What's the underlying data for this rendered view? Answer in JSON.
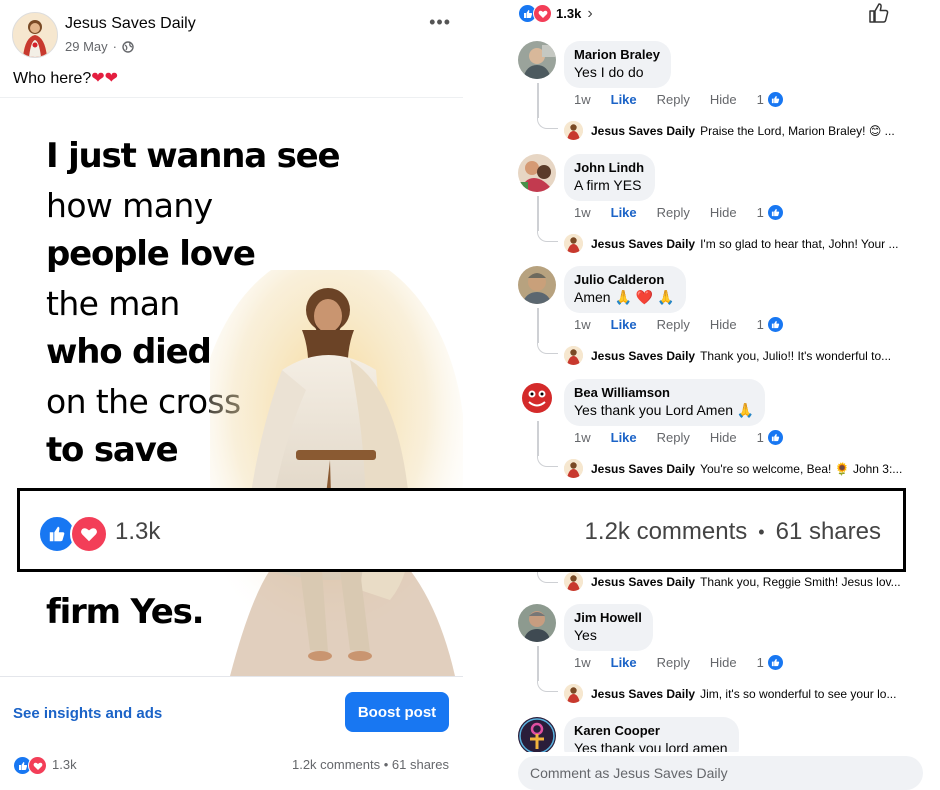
{
  "post": {
    "page_name": "Jesus Saves Daily",
    "date": "29 May",
    "separator": "·",
    "caption": "Who here?",
    "caption_emoji": "❤❤",
    "more_icon": "more-horizontal-icon",
    "image_text": {
      "line1": "I just wanna see",
      "line2": "how many",
      "line3": "people love",
      "line4": "the man",
      "line5": "who died",
      "line6": "on the cross",
      "line7": "to save",
      "final": "firm Yes."
    },
    "insights_link": "See insights and ads",
    "boost_button": "Boost post",
    "reaction_count": "1.3k",
    "comments_shares": "1.2k comments • 61 shares"
  },
  "overlay": {
    "reaction_count": "1.3k",
    "comments": "1.2k comments",
    "dot": "•",
    "shares": "61 shares"
  },
  "comments_panel": {
    "reaction_count": "1.3k",
    "chevron": "›",
    "comments": [
      {
        "name": "Marion Braley",
        "text": "Yes I do do",
        "time": "1w",
        "like": "Like",
        "reply": "Reply",
        "hide": "Hide",
        "reactions": "1",
        "reply_author": "Jesus Saves Daily",
        "reply_text": "Praise the Lord, Marion Braley! 😊 ..."
      },
      {
        "name": "John Lindh",
        "text": "A firm YES",
        "time": "1w",
        "like": "Like",
        "reply": "Reply",
        "hide": "Hide",
        "reactions": "1",
        "reply_author": "Jesus Saves Daily",
        "reply_text": "I'm so glad to hear that, John! Your ..."
      },
      {
        "name": "Julio Calderon",
        "text": "Amen 🙏 ❤️ 🙏",
        "time": "1w",
        "like": "Like",
        "reply": "Reply",
        "hide": "Hide",
        "reactions": "1",
        "reply_author": "Jesus Saves Daily",
        "reply_text": "Thank you, Julio!! It's wonderful to..."
      },
      {
        "name": "Bea Williamson",
        "text": "Yes thank you Lord Amen 🙏",
        "time": "1w",
        "like": "Like",
        "reply": "Reply",
        "hide": "Hide",
        "reactions": "1",
        "reply_author": "Jesus Saves Daily",
        "reply_text": "You're so welcome, Bea! 🌻 John 3:..."
      },
      {
        "reply_author": "Jesus Saves Daily",
        "reply_text": "Thank you, Reggie Smith! Jesus lov..."
      },
      {
        "name": "Jim Howell",
        "text": "Yes",
        "time": "1w",
        "like": "Like",
        "reply": "Reply",
        "hide": "Hide",
        "reactions": "1",
        "reply_author": "Jesus Saves Daily",
        "reply_text": "Jim, it's so wonderful to see your lo..."
      },
      {
        "name": "Karen Cooper",
        "text": "Yes thank you lord amen"
      }
    ],
    "input_placeholder": "Comment as Jesus Saves Daily"
  },
  "colors": {
    "facebook_blue": "#1877f2",
    "link_blue": "#1b63c7",
    "love_red": "#f33e58",
    "bubble_gray": "#f0f2f5",
    "meta_gray": "#65676b"
  }
}
